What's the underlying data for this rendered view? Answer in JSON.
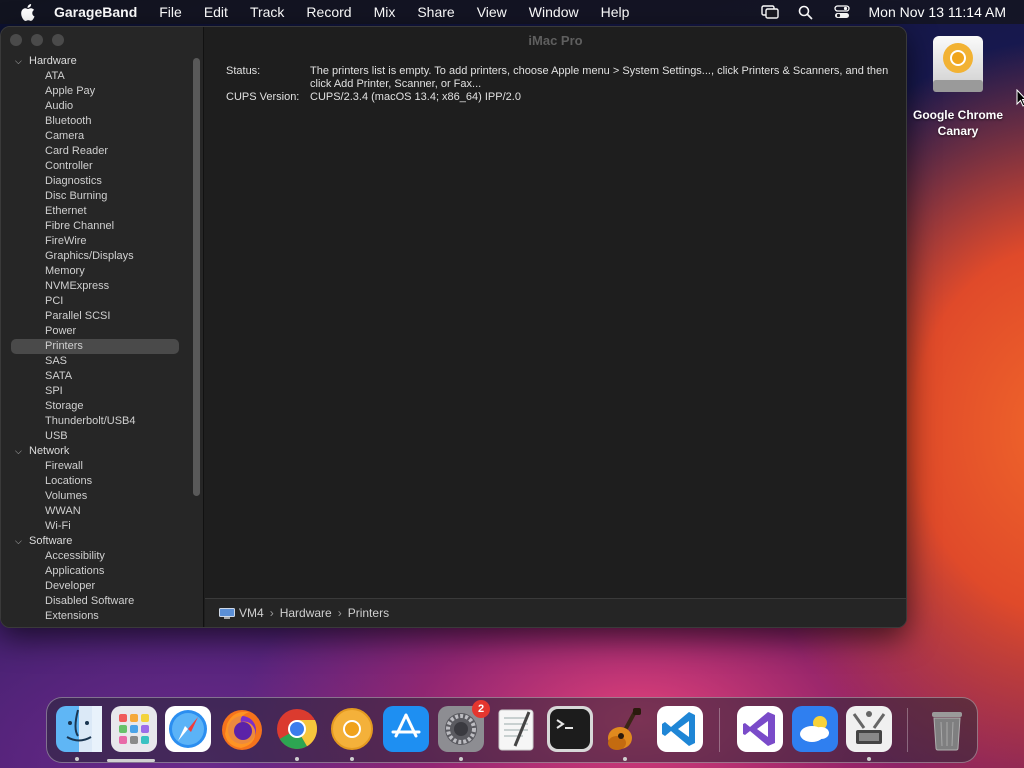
{
  "menubar": {
    "app_name": "GarageBand",
    "items": [
      "File",
      "Edit",
      "Track",
      "Record",
      "Mix",
      "Share",
      "View",
      "Window",
      "Help"
    ],
    "clock": "Mon Nov 13  11:14 AM"
  },
  "window": {
    "title": "iMac Pro",
    "tree": [
      {
        "label": "Hardware",
        "type": "category"
      },
      {
        "label": "ATA",
        "type": "item"
      },
      {
        "label": "Apple Pay",
        "type": "item"
      },
      {
        "label": "Audio",
        "type": "item"
      },
      {
        "label": "Bluetooth",
        "type": "item"
      },
      {
        "label": "Camera",
        "type": "item"
      },
      {
        "label": "Card Reader",
        "type": "item"
      },
      {
        "label": "Controller",
        "type": "item"
      },
      {
        "label": "Diagnostics",
        "type": "item"
      },
      {
        "label": "Disc Burning",
        "type": "item"
      },
      {
        "label": "Ethernet",
        "type": "item"
      },
      {
        "label": "Fibre Channel",
        "type": "item"
      },
      {
        "label": "FireWire",
        "type": "item"
      },
      {
        "label": "Graphics/Displays",
        "type": "item"
      },
      {
        "label": "Memory",
        "type": "item"
      },
      {
        "label": "NVMExpress",
        "type": "item"
      },
      {
        "label": "PCI",
        "type": "item"
      },
      {
        "label": "Parallel SCSI",
        "type": "item"
      },
      {
        "label": "Power",
        "type": "item"
      },
      {
        "label": "Printers",
        "type": "item",
        "selected": true
      },
      {
        "label": "SAS",
        "type": "item"
      },
      {
        "label": "SATA",
        "type": "item"
      },
      {
        "label": "SPI",
        "type": "item"
      },
      {
        "label": "Storage",
        "type": "item"
      },
      {
        "label": "Thunderbolt/USB4",
        "type": "item"
      },
      {
        "label": "USB",
        "type": "item"
      },
      {
        "label": "Network",
        "type": "category"
      },
      {
        "label": "Firewall",
        "type": "item"
      },
      {
        "label": "Locations",
        "type": "item"
      },
      {
        "label": "Volumes",
        "type": "item"
      },
      {
        "label": "WWAN",
        "type": "item"
      },
      {
        "label": "Wi-Fi",
        "type": "item"
      },
      {
        "label": "Software",
        "type": "category"
      },
      {
        "label": "Accessibility",
        "type": "item"
      },
      {
        "label": "Applications",
        "type": "item"
      },
      {
        "label": "Developer",
        "type": "item"
      },
      {
        "label": "Disabled Software",
        "type": "item"
      },
      {
        "label": "Extensions",
        "type": "item"
      }
    ],
    "info": {
      "status_label": "Status:",
      "status_value": "The printers list is empty. To add printers, choose Apple menu > System Settings..., click Printers & Scanners, and then click Add Printer, Scanner, or Fax...",
      "cups_label": "CUPS Version:",
      "cups_value": "CUPS/2.3.4 (macOS 13.4; x86_64) IPP/2.0"
    },
    "pathbar": [
      "VM4",
      "Hardware",
      "Printers"
    ]
  },
  "desktop": {
    "icon_label": "Google Chrome Canary"
  },
  "dock": {
    "apps": [
      {
        "name": "finder",
        "running": true
      },
      {
        "name": "launchpad",
        "running": false
      },
      {
        "name": "safari",
        "running": false
      },
      {
        "name": "firefox",
        "running": false
      },
      {
        "name": "chrome",
        "running": true
      },
      {
        "name": "chrome-canary",
        "running": true
      },
      {
        "name": "app-store",
        "running": false
      },
      {
        "name": "system-settings",
        "running": true,
        "badge": "2"
      },
      {
        "name": "textedit",
        "running": false
      },
      {
        "name": "terminal",
        "running": false
      },
      {
        "name": "garageband",
        "running": true
      },
      {
        "name": "vscode",
        "running": false
      },
      {
        "name": "visual-studio",
        "running": false
      },
      {
        "name": "weather",
        "running": false
      },
      {
        "name": "system-information",
        "running": true
      },
      {
        "name": "trash",
        "running": false
      }
    ]
  }
}
